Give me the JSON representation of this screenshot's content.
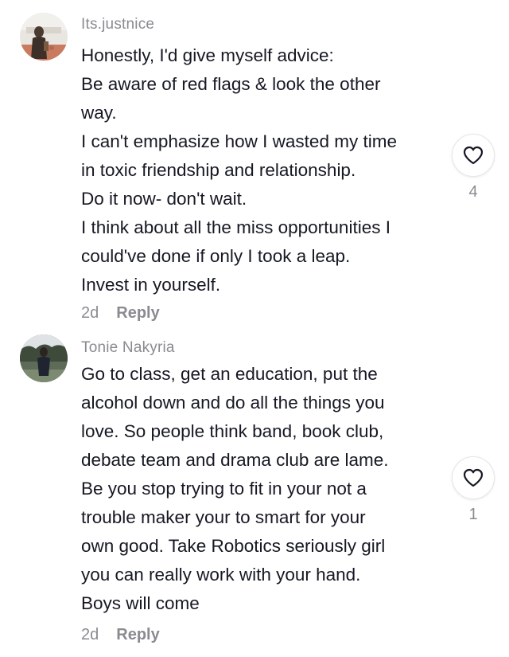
{
  "comments": [
    {
      "username": "Its.justnice",
      "lines": [
        "Honestly, I'd give myself advice:",
        "Be aware of red flags & look the other",
        "way.",
        "I can't emphasize how I wasted my time",
        "in toxic friendship and relationship.",
        "Do it now- don't wait.",
        "I think about all the miss opportunities I",
        "could've done if only I took a leap.",
        "Invest in yourself."
      ],
      "time": "2d",
      "reply_label": "Reply",
      "like_icon": "heart-outline-icon",
      "like_count": "4"
    },
    {
      "username": "Tonie Nakyria",
      "lines": [
        "Go to class, get an education, put the",
        "alcohol down and do all the things you",
        "love. So people think band, book club,",
        "debate team and drama club are lame.",
        "Be you stop trying to fit in your not a",
        "trouble maker your to smart for your",
        "own good. Take Robotics seriously girl",
        "you can really work with your hand.",
        "Boys will come"
      ],
      "time": "2d",
      "reply_label": "Reply",
      "like_icon": "heart-outline-icon",
      "like_count": "1"
    }
  ],
  "colors": {
    "text": "#161823",
    "secondary": "#8a8b91",
    "background": "#ffffff"
  }
}
